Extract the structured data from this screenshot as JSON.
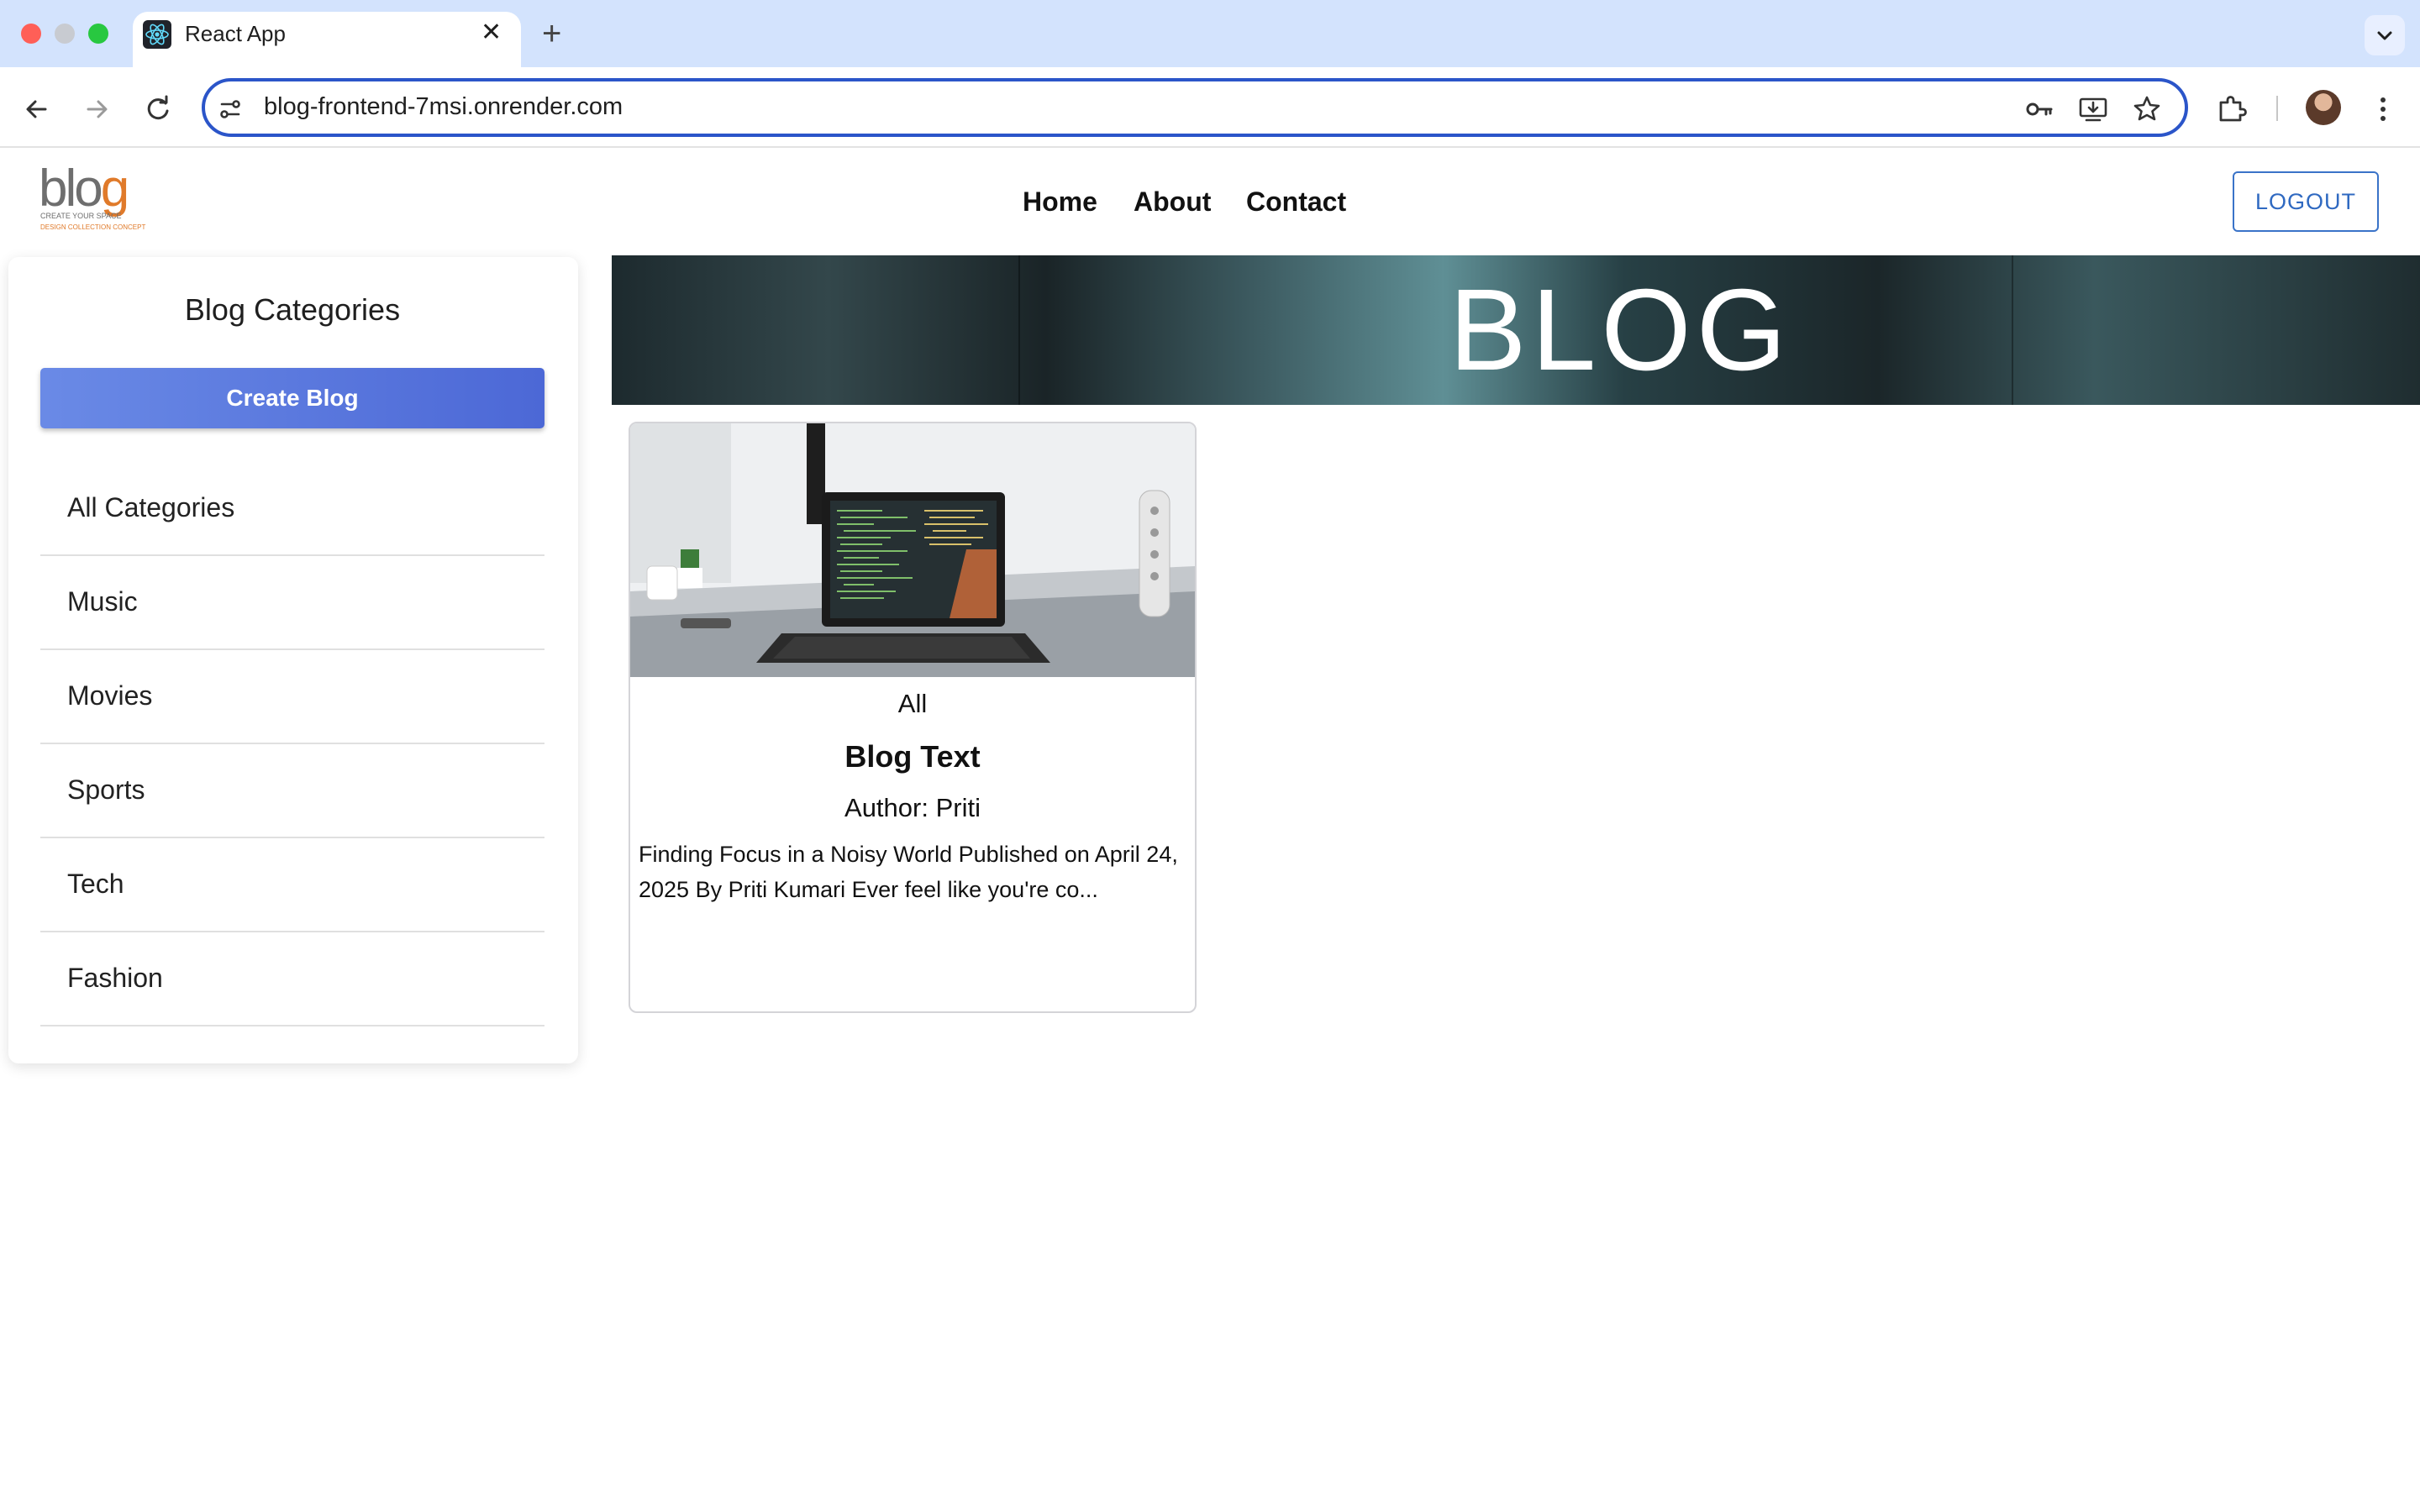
{
  "browser": {
    "tab_title": "React App",
    "url": "blog-frontend-7msi.onrender.com"
  },
  "header": {
    "logo": {
      "text_main": "blo",
      "text_g": "g",
      "tagline": "CREATE YOUR SPACE",
      "subtagline": "DESIGN COLLECTION CONCEPT"
    },
    "nav": [
      "Home",
      "About",
      "Contact"
    ],
    "logout_label": "LOGOUT"
  },
  "banner": {
    "title": "BLOG"
  },
  "sidebar": {
    "title": "Blog Categories",
    "create_label": "Create Blog",
    "categories": [
      "All Categories",
      "Music",
      "Movies",
      "Sports",
      "Tech",
      "Fashion"
    ]
  },
  "posts": [
    {
      "category": "All",
      "title": "Blog Text",
      "author": "Author: Priti",
      "excerpt": "Finding Focus in a Noisy World Published on April 24, 2025 By Priti Kumari Ever feel like you're co..."
    }
  ],
  "colors": {
    "accent": "#4c68d6",
    "logout": "#2f69c1",
    "logo_orange": "#e07a2a",
    "tabstrip": "#d3e3fd"
  }
}
